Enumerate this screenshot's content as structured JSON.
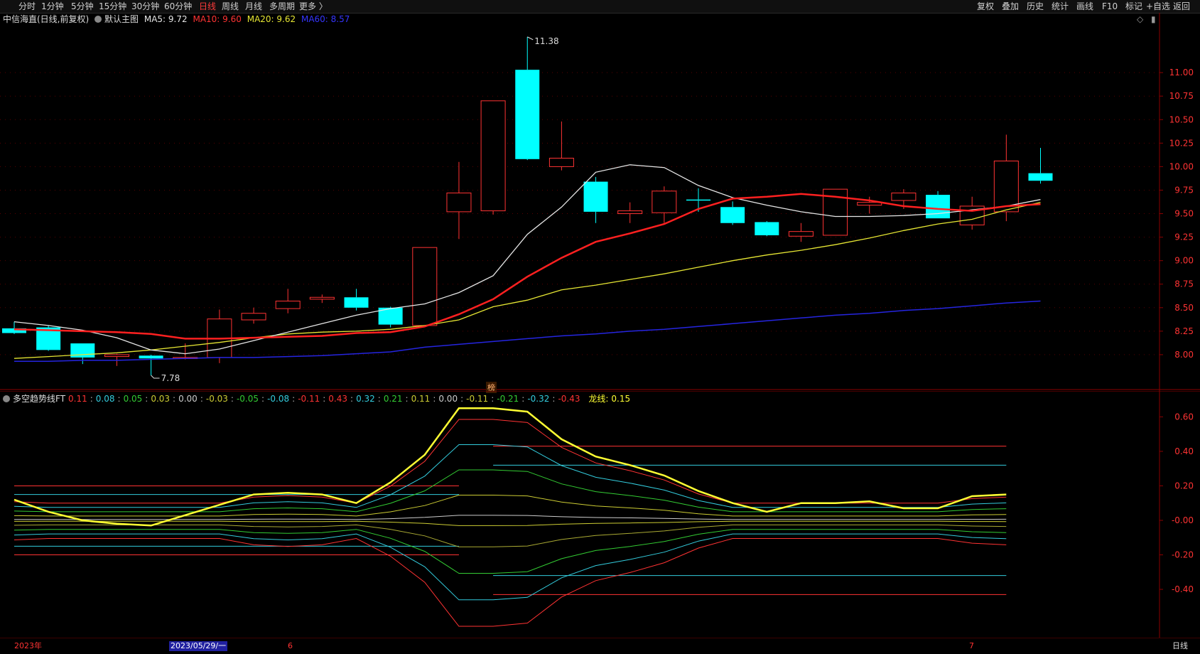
{
  "toolbar": {
    "periods": [
      "分时",
      "1分钟",
      "5分钟",
      "15分钟",
      "30分钟",
      "60分钟",
      "日线",
      "周线",
      "月线",
      "多周期",
      "更多 〉"
    ],
    "active_index": 6,
    "right_buttons": [
      "复权",
      "叠加",
      "历史",
      "统计",
      "画线",
      "F10",
      "标记",
      "+自选",
      "返回"
    ]
  },
  "main_legend": {
    "title": "中信海直(日线,前复权)",
    "indicator": "默认主图",
    "ma5": "MA5: 9.72",
    "ma10": "MA10: 9.60",
    "ma20": "MA20: 9.62",
    "ma60": "MA60: 8.57"
  },
  "sub_legend": {
    "title": "多空趋势线FT",
    "values": [
      "0.11",
      "0.08",
      "0.05",
      "0.03",
      "0.00",
      "-0.03",
      "-0.05",
      "-0.08",
      "-0.11",
      "0.43",
      "0.32",
      "0.21",
      "0.11",
      "0.00",
      "-0.11",
      "-0.21",
      "-0.32",
      "-0.43"
    ],
    "value_colors": [
      "#ff3333",
      "#33ccdd",
      "#33cc33",
      "#cccc33",
      "#cccccc",
      "#cccc33",
      "#33cc33",
      "#33ccdd",
      "#ff3333",
      "#ff3333",
      "#33ccdd",
      "#33cc33",
      "#cccc33",
      "#cccccc",
      "#cccc33",
      "#33cc33",
      "#33ccdd",
      "#ff3333"
    ],
    "dragon_label": "龙线:",
    "dragon_value": "0.15"
  },
  "marker_label": "榜",
  "bottom": {
    "year_label": "2023年",
    "cursor_date": "2023/05/29/一",
    "month_6": "6",
    "month_7": "7",
    "period_label": "日线"
  },
  "colors": {
    "up": "#ff3333",
    "down": "#00ffff",
    "ma5": "#e6e6e6",
    "ma10": "#ff2020",
    "ma20": "#e6e633",
    "ma60": "#2525e0",
    "axis": "#8b0000"
  },
  "chart_data": [
    {
      "type": "candlestick",
      "yaxis_ticks": [
        "11.00",
        "10.75",
        "10.50",
        "10.25",
        "10.00",
        "9.75",
        "9.50",
        "9.25",
        "9.00",
        "8.75",
        "8.50",
        "8.25",
        "8.00"
      ],
      "ylim": [
        7.75,
        11.5
      ],
      "high_label": "11.38",
      "low_label": "7.78",
      "candles": [
        {
          "o": 8.28,
          "h": 8.35,
          "l": 8.22,
          "c": 8.23
        },
        {
          "o": 8.29,
          "h": 8.31,
          "l": 8.04,
          "c": 8.05
        },
        {
          "o": 8.12,
          "h": 8.12,
          "l": 7.9,
          "c": 7.97
        },
        {
          "o": 7.98,
          "h": 8.01,
          "l": 7.88,
          "c": 8.0
        },
        {
          "o": 7.99,
          "h": 8.0,
          "l": 7.78,
          "c": 7.96
        },
        {
          "o": 7.97,
          "h": 8.12,
          "l": 7.95,
          "c": 7.97
        },
        {
          "o": 7.97,
          "h": 8.48,
          "l": 7.91,
          "c": 8.38
        },
        {
          "o": 8.37,
          "h": 8.5,
          "l": 8.33,
          "c": 8.44
        },
        {
          "o": 8.49,
          "h": 8.7,
          "l": 8.44,
          "c": 8.57
        },
        {
          "o": 8.59,
          "h": 8.64,
          "l": 8.55,
          "c": 8.61
        },
        {
          "o": 8.61,
          "h": 8.7,
          "l": 8.47,
          "c": 8.5
        },
        {
          "o": 8.5,
          "h": 8.51,
          "l": 8.29,
          "c": 8.32
        },
        {
          "o": 8.31,
          "h": 9.14,
          "l": 8.3,
          "c": 9.14
        },
        {
          "o": 9.52,
          "h": 10.05,
          "l": 9.23,
          "c": 9.72
        },
        {
          "o": 9.53,
          "h": 10.7,
          "l": 9.49,
          "c": 10.7
        },
        {
          "o": 11.03,
          "h": 11.38,
          "l": 10.07,
          "c": 10.08
        },
        {
          "o": 10.0,
          "h": 10.48,
          "l": 9.96,
          "c": 10.09
        },
        {
          "o": 9.84,
          "h": 9.89,
          "l": 9.4,
          "c": 9.52
        },
        {
          "o": 9.5,
          "h": 9.62,
          "l": 9.4,
          "c": 9.53
        },
        {
          "o": 9.51,
          "h": 9.79,
          "l": 9.4,
          "c": 9.74
        },
        {
          "o": 9.65,
          "h": 9.77,
          "l": 9.52,
          "c": 9.64
        },
        {
          "o": 9.57,
          "h": 9.63,
          "l": 9.38,
          "c": 9.4
        },
        {
          "o": 9.41,
          "h": 9.42,
          "l": 9.26,
          "c": 9.27
        },
        {
          "o": 9.26,
          "h": 9.4,
          "l": 9.2,
          "c": 9.31
        },
        {
          "o": 9.27,
          "h": 9.76,
          "l": 9.27,
          "c": 9.76
        },
        {
          "o": 9.59,
          "h": 9.68,
          "l": 9.5,
          "c": 9.62
        },
        {
          "o": 9.64,
          "h": 9.76,
          "l": 9.55,
          "c": 9.72
        },
        {
          "o": 9.7,
          "h": 9.74,
          "l": 9.45,
          "c": 9.45
        },
        {
          "o": 9.38,
          "h": 9.68,
          "l": 9.33,
          "c": 9.58
        },
        {
          "o": 9.52,
          "h": 10.34,
          "l": 9.42,
          "c": 10.06
        },
        {
          "o": 9.93,
          "h": 10.2,
          "l": 9.82,
          "c": 9.85
        }
      ],
      "ma5": [
        8.35,
        8.31,
        8.26,
        8.18,
        8.05,
        8.01,
        8.06,
        8.15,
        8.24,
        8.33,
        8.42,
        8.49,
        8.54,
        8.66,
        8.84,
        9.28,
        9.57,
        9.94,
        10.02,
        9.99,
        9.8,
        9.67,
        9.59,
        9.52,
        9.47,
        9.47,
        9.48,
        9.5,
        9.54,
        9.58,
        9.65
      ],
      "ma10": [
        8.27,
        8.26,
        8.25,
        8.24,
        8.22,
        8.17,
        8.17,
        8.18,
        8.19,
        8.2,
        8.23,
        8.24,
        8.3,
        8.43,
        8.59,
        8.83,
        9.03,
        9.2,
        9.29,
        9.39,
        9.55,
        9.66,
        9.68,
        9.71,
        9.68,
        9.64,
        9.58,
        9.55,
        9.53,
        9.58,
        9.6
      ],
      "ma20": [
        7.96,
        7.98,
        8.0,
        8.02,
        8.05,
        8.09,
        8.13,
        8.18,
        8.22,
        8.24,
        8.25,
        8.27,
        8.31,
        8.37,
        8.51,
        8.58,
        8.69,
        8.74,
        8.8,
        8.86,
        8.93,
        9.0,
        9.06,
        9.11,
        9.17,
        9.24,
        9.32,
        9.39,
        9.44,
        9.54,
        9.62
      ],
      "ma60": [
        7.93,
        7.93,
        7.94,
        7.94,
        7.95,
        7.96,
        7.97,
        7.97,
        7.98,
        7.99,
        8.01,
        8.03,
        8.08,
        8.11,
        8.14,
        8.17,
        8.2,
        8.22,
        8.25,
        8.27,
        8.3,
        8.33,
        8.36,
        8.39,
        8.42,
        8.44,
        8.47,
        8.49,
        8.52,
        8.55,
        8.57
      ]
    },
    {
      "type": "line",
      "title": "多空趋势线FT",
      "yaxis_ticks": [
        "0.60",
        "0.40",
        "0.20",
        "-0.00",
        "-0.20",
        "-0.40"
      ],
      "ylim": [
        -0.68,
        0.75
      ],
      "dragon": [
        0.12,
        0.05,
        0.0,
        -0.02,
        -0.03,
        0.03,
        0.09,
        0.15,
        0.16,
        0.15,
        0.1,
        0.22,
        0.38,
        0.65,
        0.65,
        0.63,
        0.47,
        0.37,
        0.32,
        0.26,
        0.17,
        0.1,
        0.05,
        0.1,
        0.1,
        0.11,
        0.07,
        0.07,
        0.14,
        0.15
      ],
      "band_levels": [
        0.43,
        0.32,
        0.21,
        0.11,
        0.0,
        -0.03,
        -0.05,
        -0.08,
        -0.11,
        -0.21,
        -0.32,
        -0.43
      ],
      "band_colors": [
        "#ff3333",
        "#33ccdd",
        "#33cc33",
        "#cccc33",
        "#cccccc",
        "#cccc33",
        "#33cc33",
        "#33ccdd",
        "#ff3333",
        "#33cc33",
        "#33ccdd",
        "#ff3333"
      ]
    }
  ]
}
